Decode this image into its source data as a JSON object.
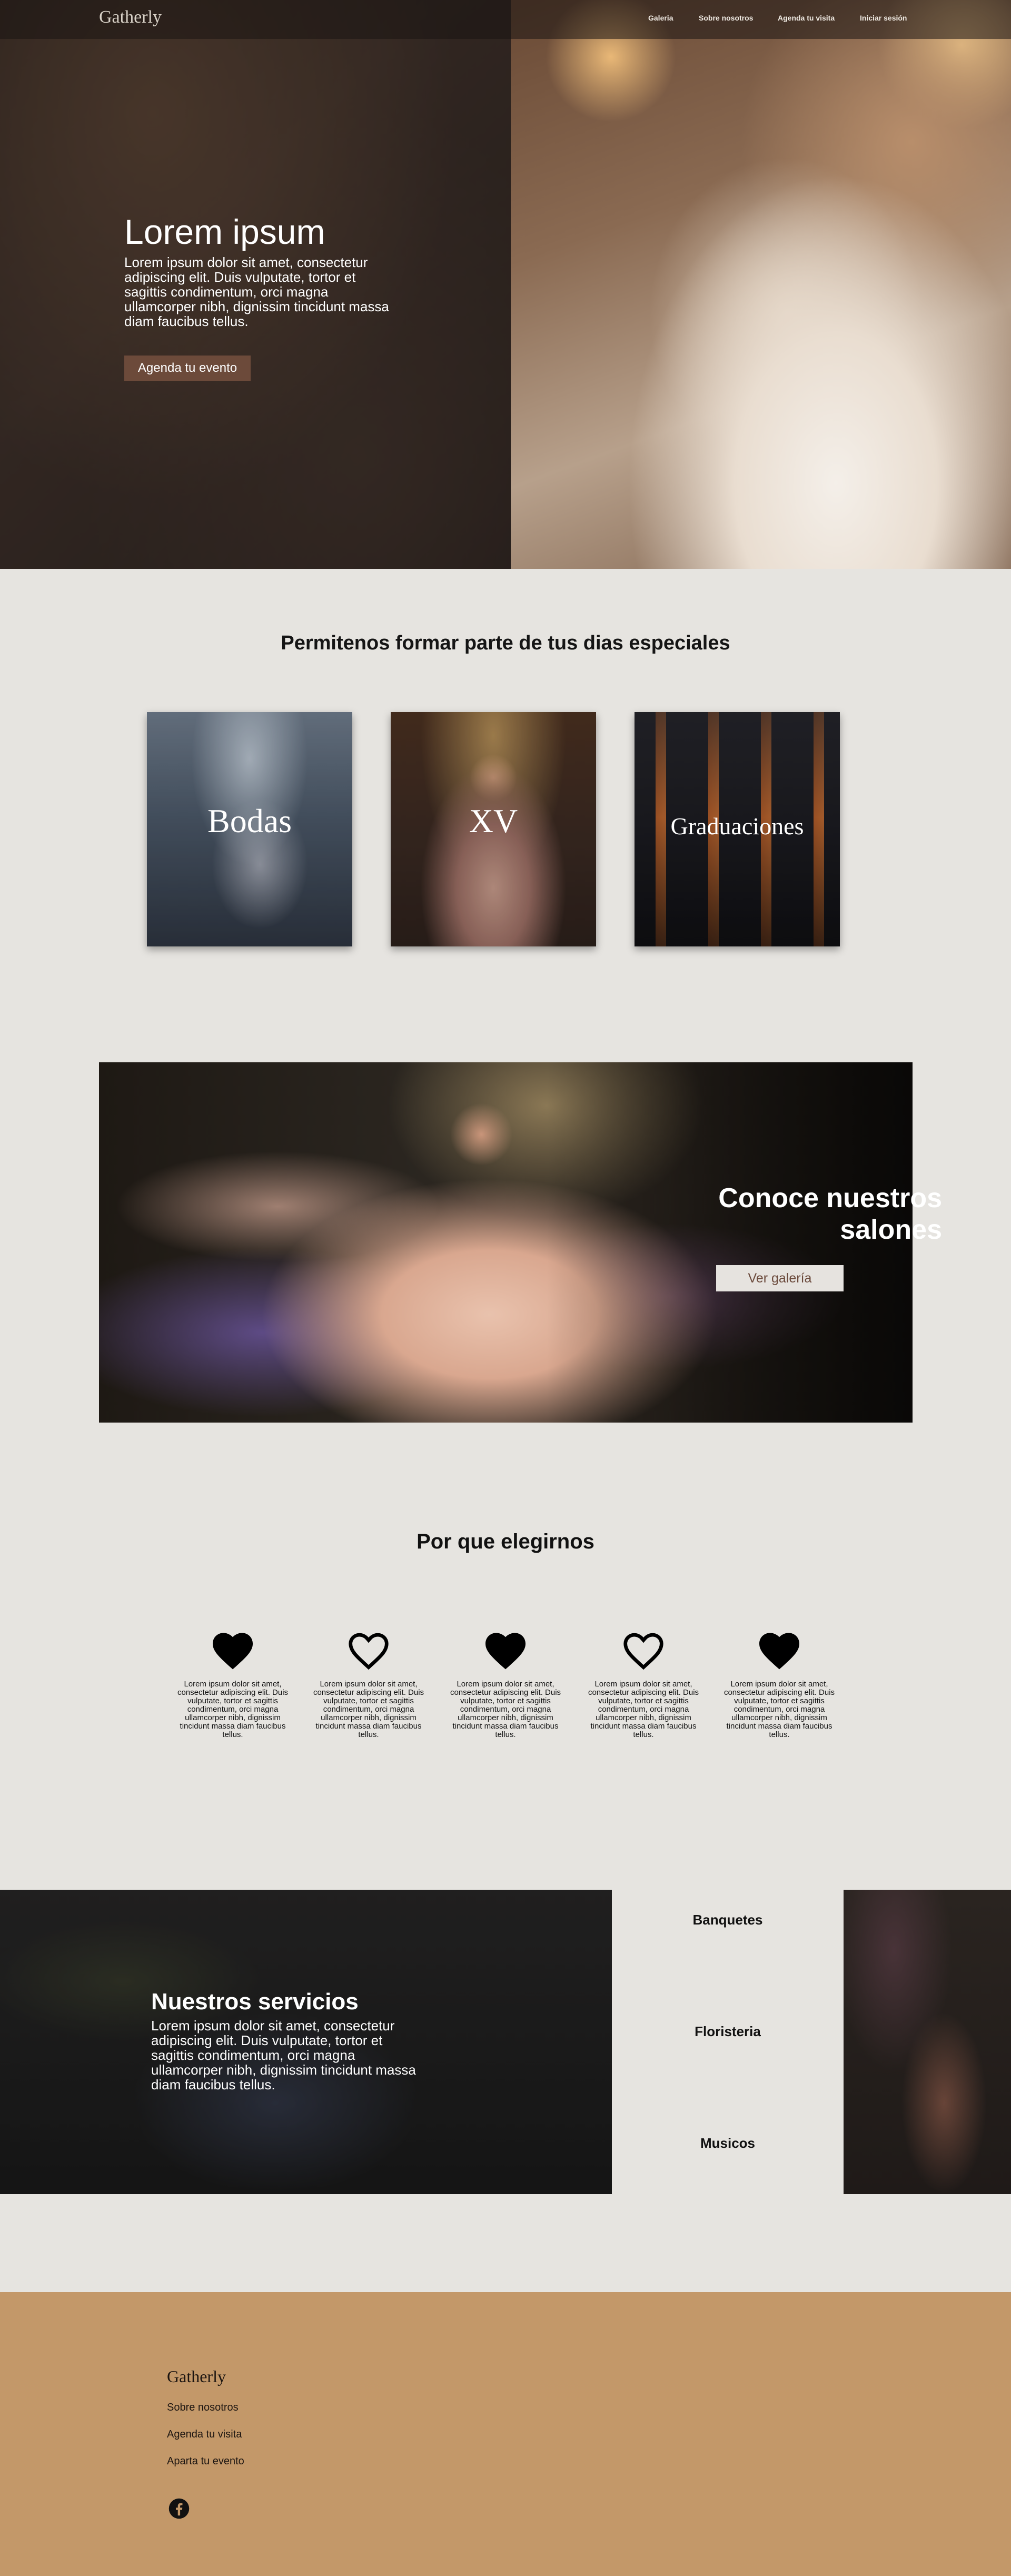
{
  "nav": {
    "brand": "Gatherly",
    "links": [
      "Galeria",
      "Sobre nosotros",
      "Agenda tu visita",
      "Iniciar sesión"
    ]
  },
  "hero": {
    "title": "Lorem ipsum",
    "body": "Lorem ipsum dolor sit amet, consectetur adipiscing elit. Duis vulputate, tortor et sagittis condimentum, orci magna ullamcorper nibh, dignissim tincidunt massa diam faucibus tellus.",
    "cta": "Agenda tu evento"
  },
  "special": {
    "title": "Permitenos formar parte de tus dias especiales",
    "cards": [
      "Bodas",
      "XV",
      "Graduaciones"
    ]
  },
  "salones": {
    "title": "Conoce nuestros salones",
    "button": "Ver galería"
  },
  "why": {
    "title": "Por que elegirnos",
    "features": [
      {
        "icon": "heart-filled-icon",
        "text": "Lorem ipsum dolor sit amet, consectetur adipiscing elit. Duis vulputate, tortor et sagittis condimentum, orci magna ullamcorper nibh, dignissim tincidunt massa diam faucibus tellus."
      },
      {
        "icon": "heart-outline-icon",
        "text": "Lorem ipsum dolor sit amet, consectetur adipiscing elit. Duis vulputate, tortor et sagittis condimentum, orci magna ullamcorper nibh, dignissim tincidunt massa diam faucibus tellus."
      },
      {
        "icon": "heart-filled-icon",
        "text": "Lorem ipsum dolor sit amet, consectetur adipiscing elit. Duis vulputate, tortor et sagittis condimentum, orci magna ullamcorper nibh, dignissim tincidunt massa diam faucibus tellus."
      },
      {
        "icon": "heart-outline-icon",
        "text": "Lorem ipsum dolor sit amet, consectetur adipiscing elit. Duis vulputate, tortor et sagittis condimentum, orci magna ullamcorper nibh, dignissim tincidunt massa diam faucibus tellus."
      },
      {
        "icon": "heart-filled-icon",
        "text": "Lorem ipsum dolor sit amet, consectetur adipiscing elit. Duis vulputate, tortor et sagittis condimentum, orci magna ullamcorper nibh, dignissim tincidunt massa diam faucibus tellus."
      }
    ]
  },
  "services": {
    "title": "Nuestros servicios",
    "body": "Lorem ipsum dolor sit amet, consectetur adipiscing elit. Duis vulputate, tortor et sagittis condimentum, orci magna ullamcorper nibh, dignissim tincidunt massa diam faucibus tellus.",
    "items": [
      "Banquetes",
      "Floristeria",
      "Musicos"
    ]
  },
  "footer": {
    "brand": "Gatherly",
    "links": [
      "Sobre nosotros",
      "Agenda tu visita",
      "Aparta tu evento"
    ],
    "social_icon": "facebook-icon"
  },
  "colors": {
    "accent_brown": "#6c4a3a",
    "footer_tan": "#c39869",
    "page_bg": "#e6e4e0"
  }
}
